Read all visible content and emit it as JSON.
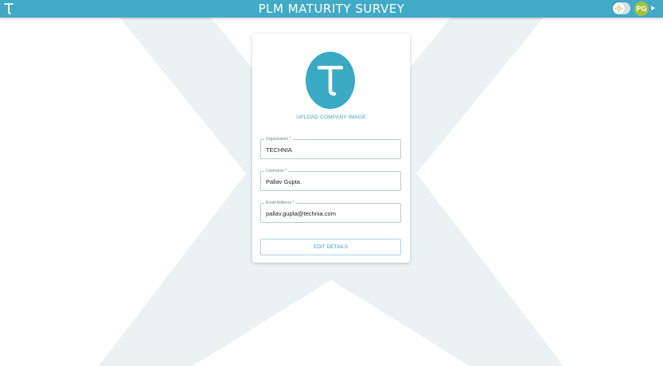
{
  "header": {
    "title": "PLM MATURITY SURVEY",
    "logo_icon": "t-logo-icon",
    "theme_toggle_icon": "sun-icon",
    "avatar_initials": "PG",
    "avatar_caret_icon": "caret-right-icon",
    "avatar_caret_glyph": "▶"
  },
  "profile": {
    "company_image_letter": "T",
    "upload_label": "UPLOAD COMPANY IMAGE",
    "fields": [
      {
        "label": "Organization *",
        "value": "TECHNIA"
      },
      {
        "label": "Username *",
        "value": "Pallav Gupta"
      },
      {
        "label": "Email Address *",
        "value": "pallav.gupta@technia.com"
      }
    ],
    "edit_button_label": "EDIT DETAILS"
  },
  "colors": {
    "header_bg": "#41aac6",
    "accent": "#3aaac4",
    "avatar_bg": "#a7c13a",
    "background_watermark": "#eaf2f4"
  }
}
